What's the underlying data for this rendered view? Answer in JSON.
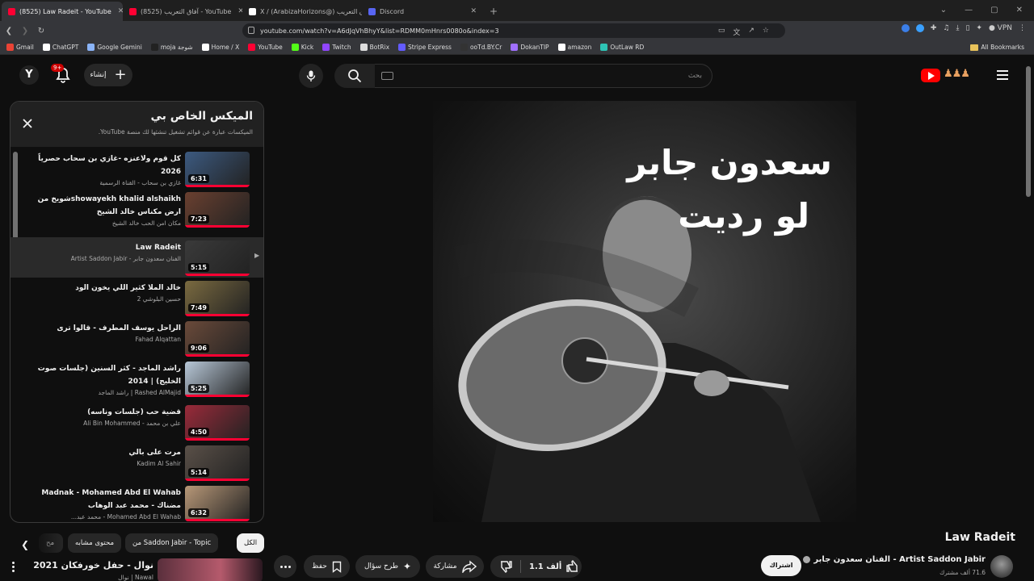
{
  "browser": {
    "tabs": [
      {
        "title": "(8525) Law Radeit - YouTube",
        "active": true,
        "icon": "youtube-icon",
        "color": "#ff0033"
      },
      {
        "title": "(8525) آفاق التعريب - YouTube",
        "active": false,
        "icon": "youtube-icon",
        "color": "#ff0033"
      },
      {
        "title": "X / (ArabizaHorizons@) آفاق التعريب",
        "active": false,
        "icon": "x-icon",
        "color": "#ffffff"
      },
      {
        "title": "Discord",
        "active": false,
        "icon": "discord-icon",
        "color": "#5865f2"
      }
    ],
    "new_tab": "+",
    "url": "youtube.com/watch?v=A6dJqVhBhyY&list=RDMM0mHnrs0080o&index=3",
    "vpn_label": "VPN",
    "bookmarks": [
      {
        "label": "Gmail",
        "color": "#ea4335"
      },
      {
        "label": "ChatGPT",
        "color": "#ffffff"
      },
      {
        "label": "Google Gemini",
        "color": "#8ab4f8"
      },
      {
        "label": "moja شوجة",
        "color": "#222222"
      },
      {
        "label": "Home / X",
        "color": "#ffffff"
      },
      {
        "label": "YouTube",
        "color": "#ff0033"
      },
      {
        "label": "Kick",
        "color": "#53fc18"
      },
      {
        "label": "Twitch",
        "color": "#9146ff"
      },
      {
        "label": "BotRix",
        "color": "#dddddd"
      },
      {
        "label": "Stripe Express",
        "color": "#635bff"
      },
      {
        "label": "ooTd.BY.Cr",
        "color": "#333333"
      },
      {
        "label": "DokanTIP",
        "color": "#a070ff"
      },
      {
        "label": "amazon",
        "color": "#ffffff"
      },
      {
        "label": "OutLaw RD",
        "color": "#2ec4b6"
      }
    ],
    "all_bookmarks": "All Bookmarks"
  },
  "header": {
    "avatar_letter": "Y",
    "notif_badge": "9+",
    "create_label": "إنشاء",
    "search_placeholder": "بحث"
  },
  "playlist": {
    "title": "الميكس الخاص بي",
    "subtitle": "الميكسات عبارة عن قوائم تشغيل تنشئها لك منصة YouTube.",
    "items": [
      {
        "title": "كل قوم ولاعنزه -غازي بن سحاب حصرياً 2026",
        "channel": "غازي بن سحاب - القناة الرسمية",
        "duration": "6:31",
        "current": false,
        "thumb": "#3c5a80"
      },
      {
        "title": "showayekh khalid alshaikhشويخ من ارض مكناس خالد الشيخ",
        "channel": "مكان امن الحب خالد الشيخ",
        "duration": "7:23",
        "current": false,
        "thumb": "#6a4030"
      },
      {
        "title": "Law Radeit",
        "channel": "الفنان سعدون جابر - Artist Saddon Jabir",
        "duration": "5:15",
        "current": true,
        "thumb": "#3a3a3a"
      },
      {
        "title": "خالد الملا كثير اللي يخون الود",
        "channel": "حسين البلوشي 2",
        "duration": "7:49",
        "current": false,
        "thumb": "#7a6a40"
      },
      {
        "title": "الراحل يوسف المطرف - قالوا ترى",
        "channel": "Fahad Alqattan",
        "duration": "9:06",
        "current": false,
        "thumb": "#6a4a3a"
      },
      {
        "title": "راشد الماجد - كثر السنين (جلسات صوت الخليج) | 2014",
        "channel": "Rashed AlMajid | راشد الماجد",
        "duration": "5:25",
        "current": false,
        "thumb": "#b8c8d8"
      },
      {
        "title": "قضية حب (جلسات وناسه)",
        "channel": "علي بن محمد - Ali Bin Mohammed",
        "duration": "4:50",
        "current": false,
        "thumb": "#9a2a3a"
      },
      {
        "title": "مرت على بالي",
        "channel": "Kadim Al Sahir",
        "duration": "5:14",
        "current": false,
        "thumb": "#5a5048"
      },
      {
        "title": "Madnak - Mohamed Abd El Wahab مضناك - محمد عبد الوهاب",
        "channel": "Mohamed Abd El Wahab - محمد عبد...",
        "duration": "6:32",
        "current": false,
        "thumb": "#b89878"
      }
    ]
  },
  "chips": {
    "all": "الكل",
    "from": "من Saddon Jabir - Topic",
    "similar": "محتوى مشابه",
    "partial": "مح"
  },
  "next_up": {
    "title": "نوال - حفل خورفكان 2021",
    "channel": "Nawal | نوال"
  },
  "video": {
    "overlay_line1": "سعدون جابر",
    "overlay_line2": "لو رديت",
    "title": "Law Radeit",
    "channel": "الفنان سعدون جابر - Artist Saddon Jabir",
    "subscribers": "71.6 ألف مشترك",
    "subscribe_label": "اشتراك",
    "likes": "1.1 ألف",
    "share_label": "مشاركة",
    "ask_label": "طرح سؤال",
    "save_label": "حفظ"
  }
}
